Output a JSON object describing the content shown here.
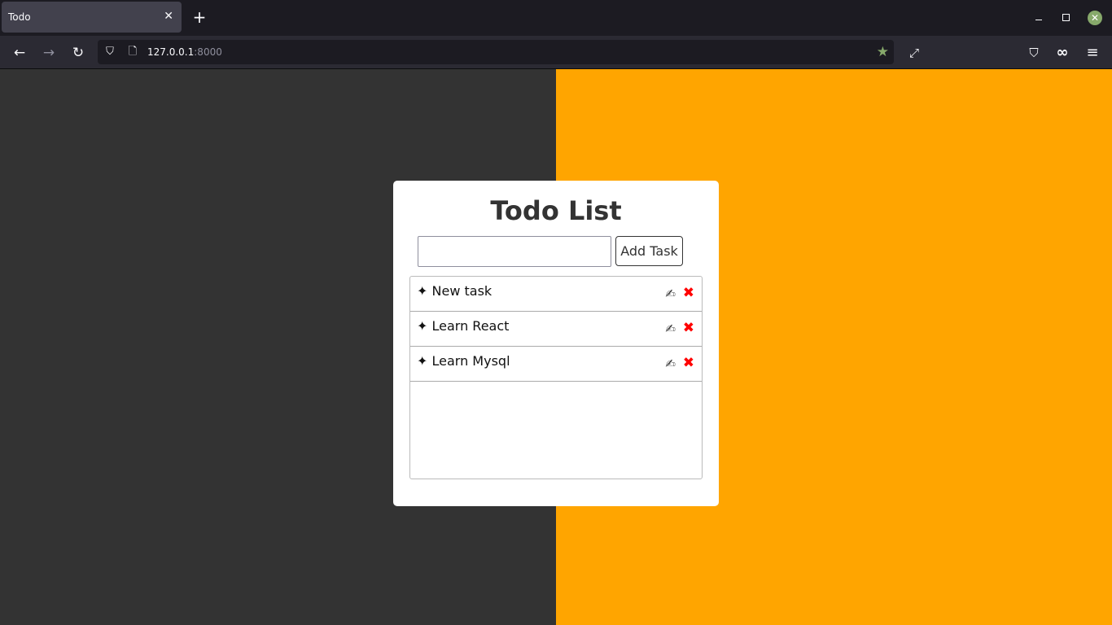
{
  "browser": {
    "tab_title": "Todo",
    "tab_close": "✕",
    "new_tab": "+",
    "url_host": "127.0.0.1",
    "url_port": ":8000",
    "window_close": "✕"
  },
  "icons": {
    "back": "←",
    "forward": "→",
    "reload": "↻",
    "shield": "⛉",
    "page": "🗋",
    "bookmark_star": "★",
    "fullscreen": "⤢",
    "pocket": "⛉",
    "extension": "∞",
    "menu": "≡"
  },
  "colors": {
    "left_background": "#333333",
    "right_background": "#ffa500",
    "delete_accent": "#ff0000"
  },
  "app": {
    "title": "Todo List",
    "input_value": "",
    "add_button_label": "Add Task",
    "tasks": [
      {
        "bullet": "✦",
        "text": "New task",
        "edit_icon": "✍",
        "delete_icon": "✖"
      },
      {
        "bullet": "✦",
        "text": "Learn React",
        "edit_icon": "✍",
        "delete_icon": "✖"
      },
      {
        "bullet": "✦",
        "text": "Learn Mysql",
        "edit_icon": "✍",
        "delete_icon": "✖"
      }
    ]
  }
}
